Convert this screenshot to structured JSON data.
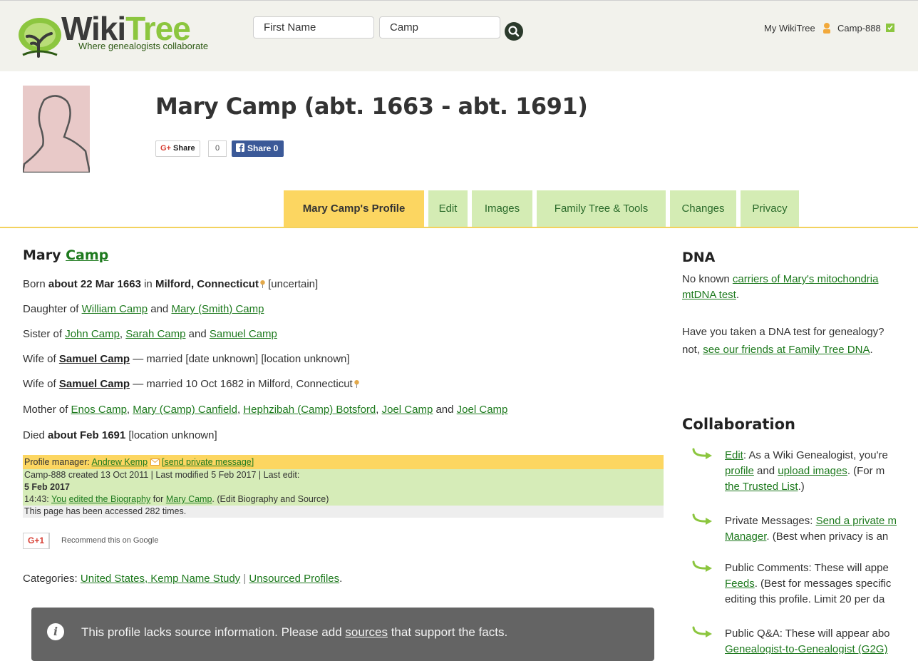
{
  "header": {
    "logo": {
      "brand": "WikiTree",
      "brand_part1": "Wiki",
      "brand_part2": "Tree",
      "tagline": "Where genealogists collaborate"
    },
    "search": {
      "first_name_placeholder": "First Name",
      "last_name_value": "Camp"
    },
    "my_wikitree": "My WikiTree",
    "user_id": "Camp-888"
  },
  "profile": {
    "title": "Mary Camp (abt. 1663 - abt. 1691)",
    "share": {
      "gplus_label": "Share",
      "gplus_count": "0",
      "facebook_label": "Share 0"
    }
  },
  "tabs": [
    {
      "label": "Mary Camp's Profile",
      "active": true
    },
    {
      "label": "Edit"
    },
    {
      "label": "Images"
    },
    {
      "label": "Family Tree & Tools"
    },
    {
      "label": "Changes"
    },
    {
      "label": "Privacy"
    }
  ],
  "bio": {
    "heading_first": "Mary",
    "heading_last": "Camp",
    "born": {
      "prefix": "Born",
      "date": "about 22 Mar 1663",
      "in": "in",
      "place": "Milford, Connecticut",
      "note": "[uncertain]"
    },
    "daughter": {
      "prefix": "Daughter of",
      "father": "William Camp",
      "and": "and",
      "mother": "Mary (Smith) Camp"
    },
    "sister": {
      "prefix": "Sister of",
      "s1": "John Camp",
      "sep": ",",
      "s2": "Sarah Camp",
      "and": "and",
      "s3": "Samuel Camp"
    },
    "wife1": {
      "prefix": "Wife of",
      "spouse": "Samuel Camp",
      "rest": "— married [date unknown] [location unknown]"
    },
    "wife2": {
      "prefix": "Wife of",
      "spouse": "Samuel Camp",
      "rest": "— married 10 Oct 1682 in Milford, Connecticut"
    },
    "mother": {
      "prefix": "Mother of",
      "c1": "Enos Camp",
      "c2": "Mary (Camp) Canfield",
      "c3": "Hephzibah (Camp) Botsford",
      "c4": "Joel Camp",
      "and": "and",
      "c5": "Joel Camp"
    },
    "died": {
      "prefix": "Died",
      "date": "about Feb 1691",
      "place": "[location unknown]"
    }
  },
  "manager": {
    "label": "Profile manager:",
    "name": "Andrew Kemp",
    "pm_link": "[send private message]",
    "created": "Camp-888 created 13 Oct 2011 | Last modified 5 Feb 2017 | Last edit:",
    "last_edit_date": "5 Feb 2017",
    "edit_time": "14:43:",
    "edit_you": "You",
    "edit_action": "edited the Biography",
    "edit_for": "for",
    "edit_profile": "Mary Camp",
    "edit_detail": ". (Edit Biography and Source)",
    "accessed": "This page has been accessed 282 times.",
    "gplus1_label": "G+1",
    "recommend": "Recommend this on Google"
  },
  "categories": {
    "prefix": "Categories:",
    "cat1": "United States, Kemp Name Study",
    "sep": "|",
    "cat2": "Unsourced Profiles",
    "end": "."
  },
  "notice": {
    "icon": "i",
    "text_before": "This profile lacks source information. Please add",
    "link": "sources",
    "text_after": "that support the facts."
  },
  "dna": {
    "heading": "DNA",
    "line1_pre": "No known",
    "line1_link": "carriers of Mary's mitochondria",
    "line2_link": "mtDNA test",
    "line2_end": ".",
    "q_line1": "Have you taken a DNA test for genealogy?",
    "q_line2_pre": "not,",
    "q_line2_link": "see our friends at Family Tree DNA",
    "q_line2_end": "."
  },
  "collaboration": {
    "heading": "Collaboration",
    "items": [
      {
        "l1_link": "Edit",
        "l1_text": ": As a Wiki Genealogist, you're",
        "l2_link1": "profile",
        "l2_mid": "and",
        "l2_link2": "upload images",
        "l2_end": ". (For m",
        "l3_link": "the Trusted List",
        "l3_end": ".)"
      },
      {
        "l1_text": "Private Messages:",
        "l1_link": "Send a private m",
        "l2_link": "Manager",
        "l2_end": ". (Best when privacy is an"
      },
      {
        "l1_text": "Public Comments: These will appe",
        "l2_link": "Feeds",
        "l2_end": ". (Best for messages specific",
        "l3_text": "editing this profile. Limit 20 per da"
      },
      {
        "l1_text": "Public Q&A: These will appear abo",
        "l2_text": "Genealogist-to-Genealogist (G2G)"
      }
    ]
  },
  "colors": {
    "tab_active": "#fcd661",
    "tab": "#d4ecb4",
    "link": "#1e7a1e",
    "notice_bg": "#646464",
    "manager_yellow": "#fcd661",
    "manager_green": "#d6ecb8"
  }
}
